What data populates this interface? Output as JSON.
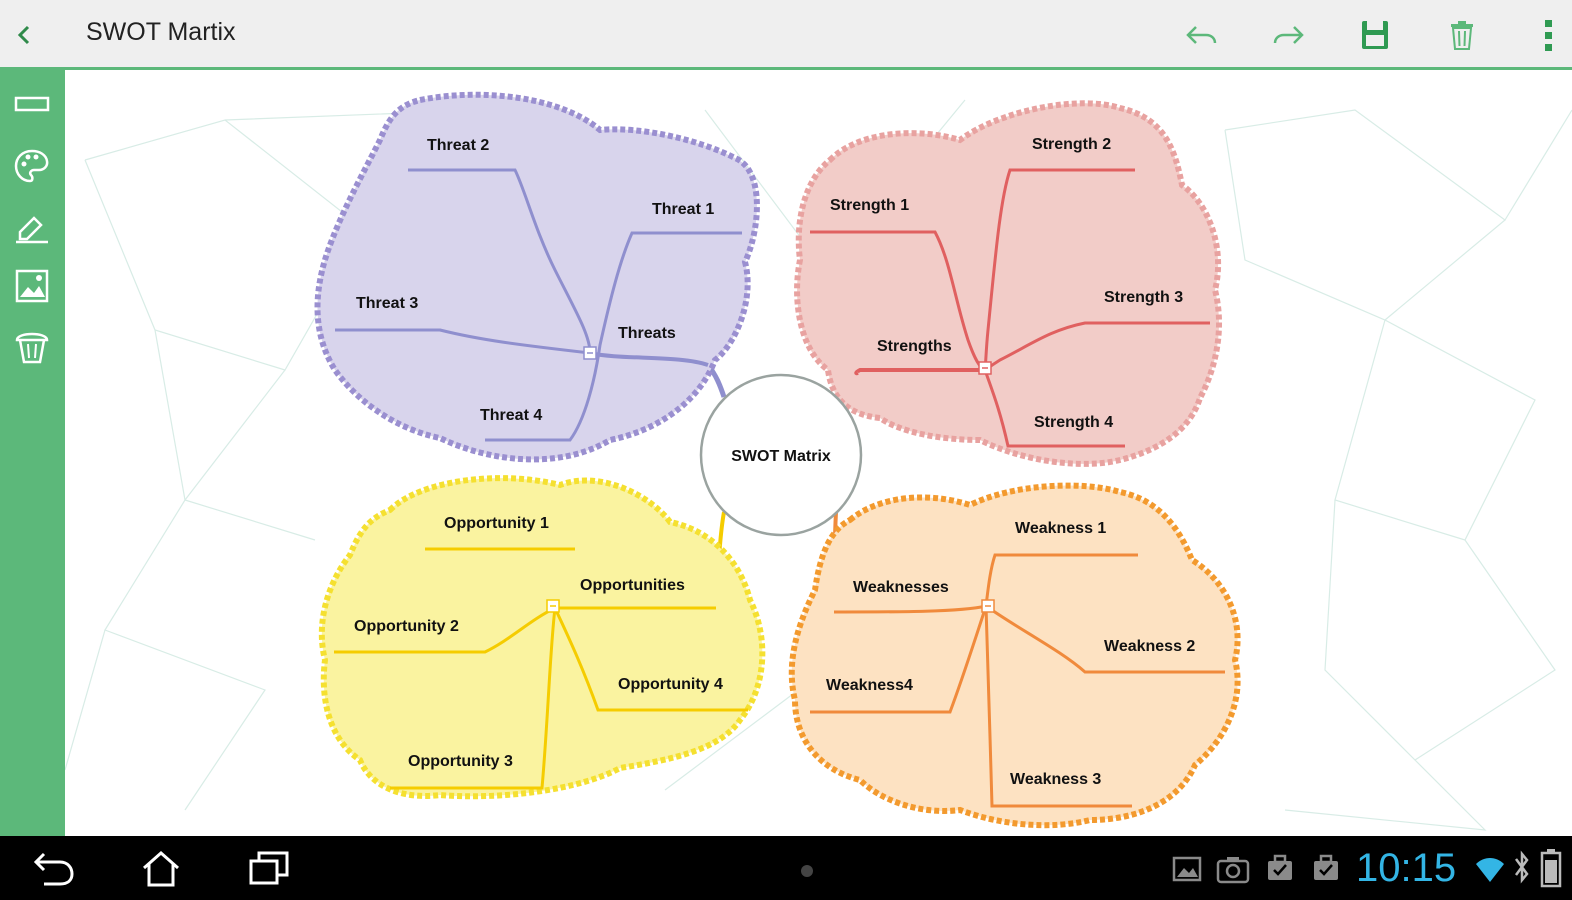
{
  "app": {
    "title": "SWOT Martix"
  },
  "toolbar": {
    "back_icon": "chevron-left-icon",
    "undo_icon": "undo-icon",
    "redo_icon": "redo-icon",
    "save_icon": "save-icon",
    "delete_icon": "trash-icon",
    "menu_icon": "overflow-menu-icon"
  },
  "sidebar": {
    "items": [
      {
        "icon": "rectangle-shape-icon"
      },
      {
        "icon": "palette-icon"
      },
      {
        "icon": "edit-icon"
      },
      {
        "icon": "image-icon"
      },
      {
        "icon": "recycle-bin-icon"
      }
    ]
  },
  "mindmap": {
    "center": "SWOT Matrix",
    "threats": {
      "title": "Threats",
      "items": [
        "Threat 1",
        "Threat 2",
        "Threat 3",
        "Threat 4"
      ],
      "color": "#8f8fce"
    },
    "strengths": {
      "title": "Strengths",
      "items": [
        "Strength 1",
        "Strength 2",
        "Strength 3",
        "Strength 4"
      ],
      "color": "#e06060"
    },
    "opportunities": {
      "title": "Opportunities",
      "items": [
        "Opportunity 1",
        "Opportunity 2",
        "Opportunity 3",
        "Opportunity 4"
      ],
      "color": "#f5cc00"
    },
    "weaknesses": {
      "title": "Weaknesses",
      "items": [
        "Weakness 1",
        "Weakness 2",
        "Weakness 3",
        "Weakness4"
      ],
      "color": "#f08a3c"
    }
  },
  "statusbar": {
    "time": "10:15",
    "accent": "#33b5e5"
  },
  "colors": {
    "accent": "#5cb87a"
  }
}
